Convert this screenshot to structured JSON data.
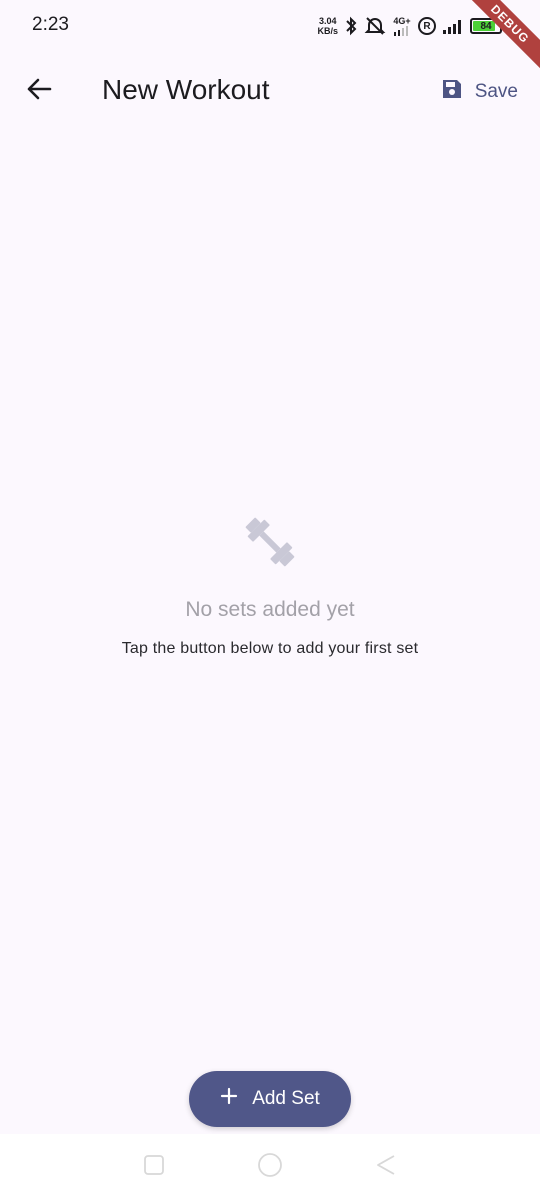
{
  "status_bar": {
    "time": "2:23",
    "net_speed_value": "3.04",
    "net_speed_unit": "KB/s",
    "network_type": "4G+",
    "roaming_badge": "R",
    "battery_level": "84",
    "battery_fraction": 0.84,
    "icons": [
      "bluetooth-icon",
      "mute-icon",
      "network-4g-icon",
      "roaming-icon",
      "signal-icon",
      "battery-icon"
    ]
  },
  "debug_banner": "DEBUG",
  "app_bar": {
    "title": "New Workout",
    "save_label": "Save",
    "back_icon": "arrow-back-icon",
    "save_icon": "save-icon"
  },
  "empty_state": {
    "icon": "fitness-center-icon",
    "title": "No sets added yet",
    "subtitle": "Tap the button below to add your first set"
  },
  "fab": {
    "label": "Add Set",
    "icon": "plus-icon"
  },
  "nav_bar": {
    "items": [
      "recents-button",
      "home-button",
      "back-nav-button"
    ]
  },
  "colors": {
    "background": "#fcf8fe",
    "primary": "#505789",
    "accent_text": "#4d5483",
    "muted_text": "#a3a1a8",
    "battery_fill": "#4cd137",
    "debug_ribbon": "#b0413e"
  }
}
